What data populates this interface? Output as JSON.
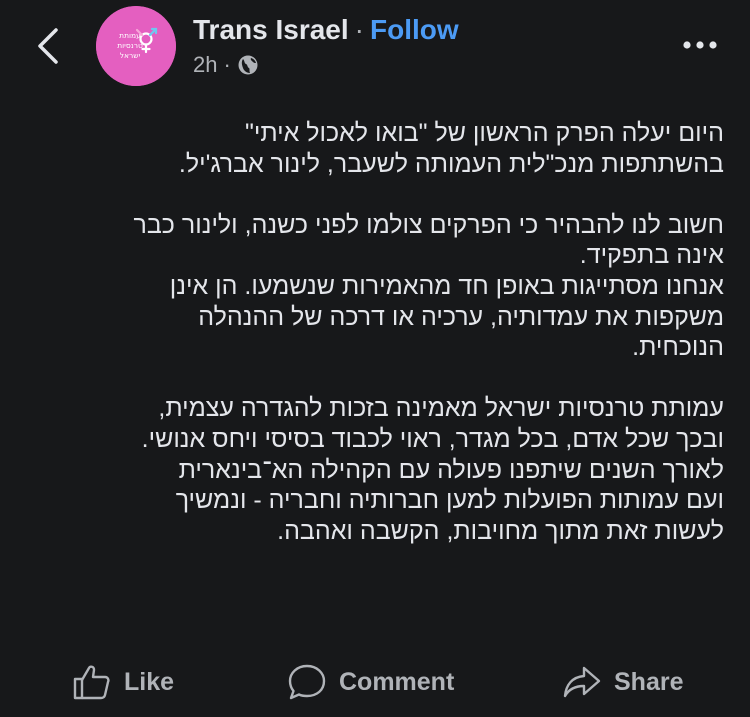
{
  "header": {
    "back_icon": "chevron-left-icon",
    "page_name": "Trans Israel",
    "separator": "·",
    "follow_label": "Follow",
    "time": "2h",
    "meta_separator": "·",
    "audience_icon": "globe-icon",
    "more_icon": "more-horizontal-icon",
    "avatar": {
      "line1": "עמותת",
      "line2": "טרנסיות",
      "line3": "ישראל",
      "color": "#e45fc0"
    }
  },
  "post": {
    "paragraphs": [
      {
        "lines": [
          "היום יעלה הפרק הראשון של \"בואו לאכול איתי\"",
          "בהשתתפות מנכ\"לית העמותה לשעבר, לינור אברג'יל."
        ]
      },
      {
        "lines": [
          "חשוב לנו להבהיר כי הפרקים צולמו לפני כשנה, ולינור כבר",
          "אינה בתפקיד.",
          "אנחנו מסתייגות באופן חד מהאמירות שנשמעו. הן אינן",
          "משקפות את עמדותיה, ערכיה או דרכה של ההנהלה",
          "הנוכחית."
        ]
      },
      {
        "lines": [
          "עמותת טרנסיות ישראל מאמינה בזכות להגדרה עצמית,",
          "ובכך שכל אדם, בכל מגדר, ראוי לכבוד בסיסי ויחס אנושי.",
          "לאורך השנים שיתפנו פעולה עם הקהילה הא־בינארית",
          "ועם עמותות הפועלות למען חברותיה וחבריה - ונמשיך",
          "לעשות זאת מתוך מחויבות, הקשבה ואהבה."
        ]
      }
    ]
  },
  "actions": {
    "like_label": "Like",
    "comment_label": "Comment",
    "share_label": "Share"
  },
  "colors": {
    "background": "#17181a",
    "text": "#e4e6eb",
    "secondary": "#b0b3b8",
    "link": "#4c9bf5"
  }
}
